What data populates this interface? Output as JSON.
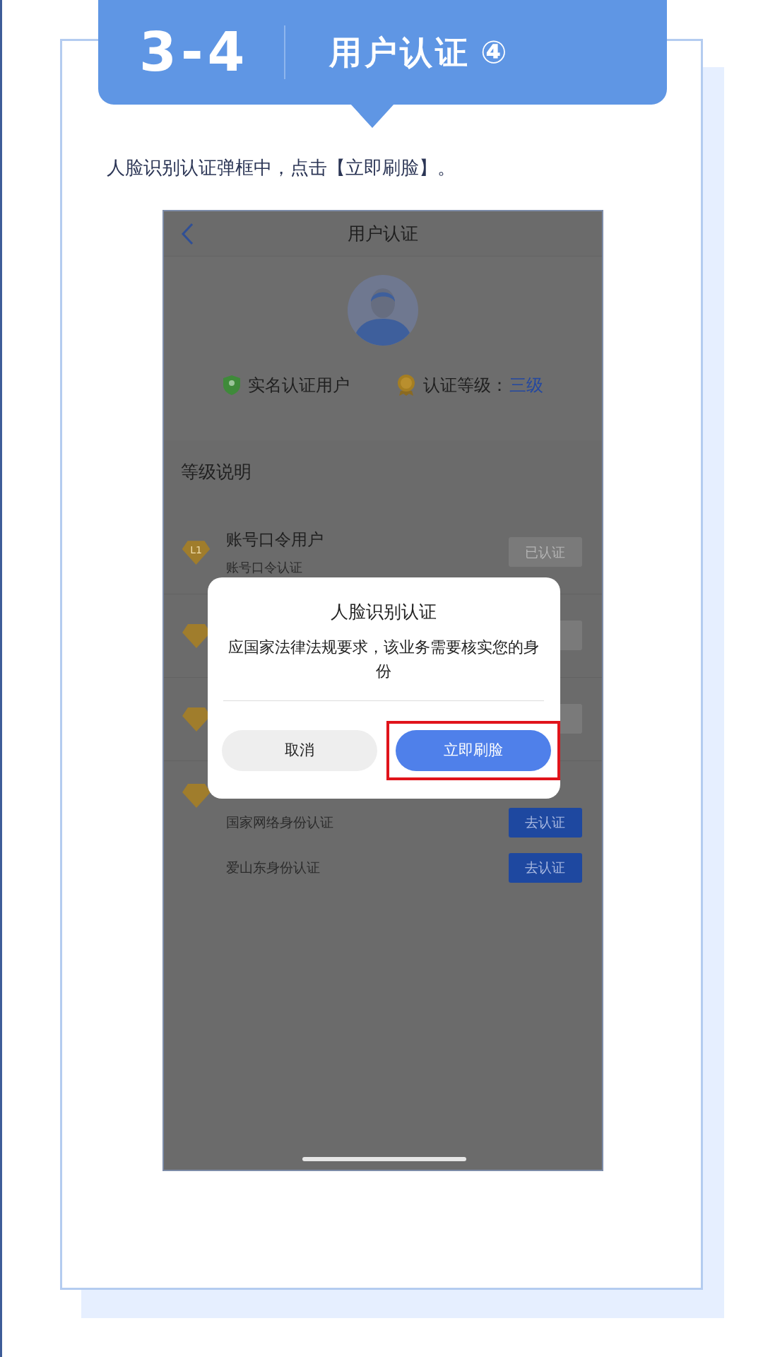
{
  "header": {
    "number": "3-4",
    "title": "用户认证",
    "step": "④"
  },
  "instruction": "人脸识别认证弹框中，点击【立即刷脸】。",
  "phone": {
    "nav_title": "用户认证",
    "status": [
      {
        "kind": "verified",
        "label": "实名认证用户"
      },
      {
        "kind": "level",
        "label": "认证等级：",
        "value": "三级"
      }
    ],
    "section_title": "等级说明",
    "levels": [
      {
        "badge": "L1",
        "title": "账号口令用户",
        "subtitle": "账号口令认证",
        "button": {
          "label": "已认证",
          "verified": true
        }
      },
      {
        "button": {
          "verified": true
        }
      },
      {
        "button": {
          "verified": true
        }
      },
      {
        "methods": [
          {
            "label": "国家网络身份认证",
            "button": {
              "label": "去认证",
              "verified": false
            }
          },
          {
            "label": "爱山东身份认证",
            "button": {
              "label": "去认证",
              "verified": false
            }
          }
        ]
      }
    ],
    "dialog": {
      "title": "人脸识别认证",
      "message": "应国家法律法规要求，该业务需要核实您的身份",
      "buttons": [
        {
          "label": "取消",
          "kind": "secondary",
          "highlighted": false
        },
        {
          "label": "立即刷脸",
          "kind": "primary",
          "highlighted": true
        }
      ]
    }
  }
}
